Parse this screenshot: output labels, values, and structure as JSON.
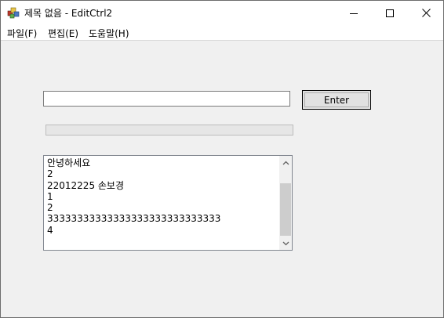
{
  "window": {
    "title": "제목 없음 - EditCtrl2",
    "icon": "mfc-app-icon"
  },
  "caption_buttons": {
    "minimize": "minimize-icon",
    "maximize": "maximize-icon",
    "close": "close-icon"
  },
  "menu": {
    "items": [
      {
        "label": "파일(F)"
      },
      {
        "label": "편집(E)"
      },
      {
        "label": "도움말(H)"
      }
    ]
  },
  "form": {
    "input_value": "",
    "enter_label": "Enter",
    "progress": 0
  },
  "listbox": {
    "lines": [
      "안녕하세요",
      "2",
      "22012225 손보경",
      "1",
      "2",
      "33333333333333333333333333333",
      "4"
    ]
  },
  "colors": {
    "client_background": "#f0f0f0",
    "progress_fill": "#06b025",
    "scroll_thumb": "#cdcdcd"
  }
}
